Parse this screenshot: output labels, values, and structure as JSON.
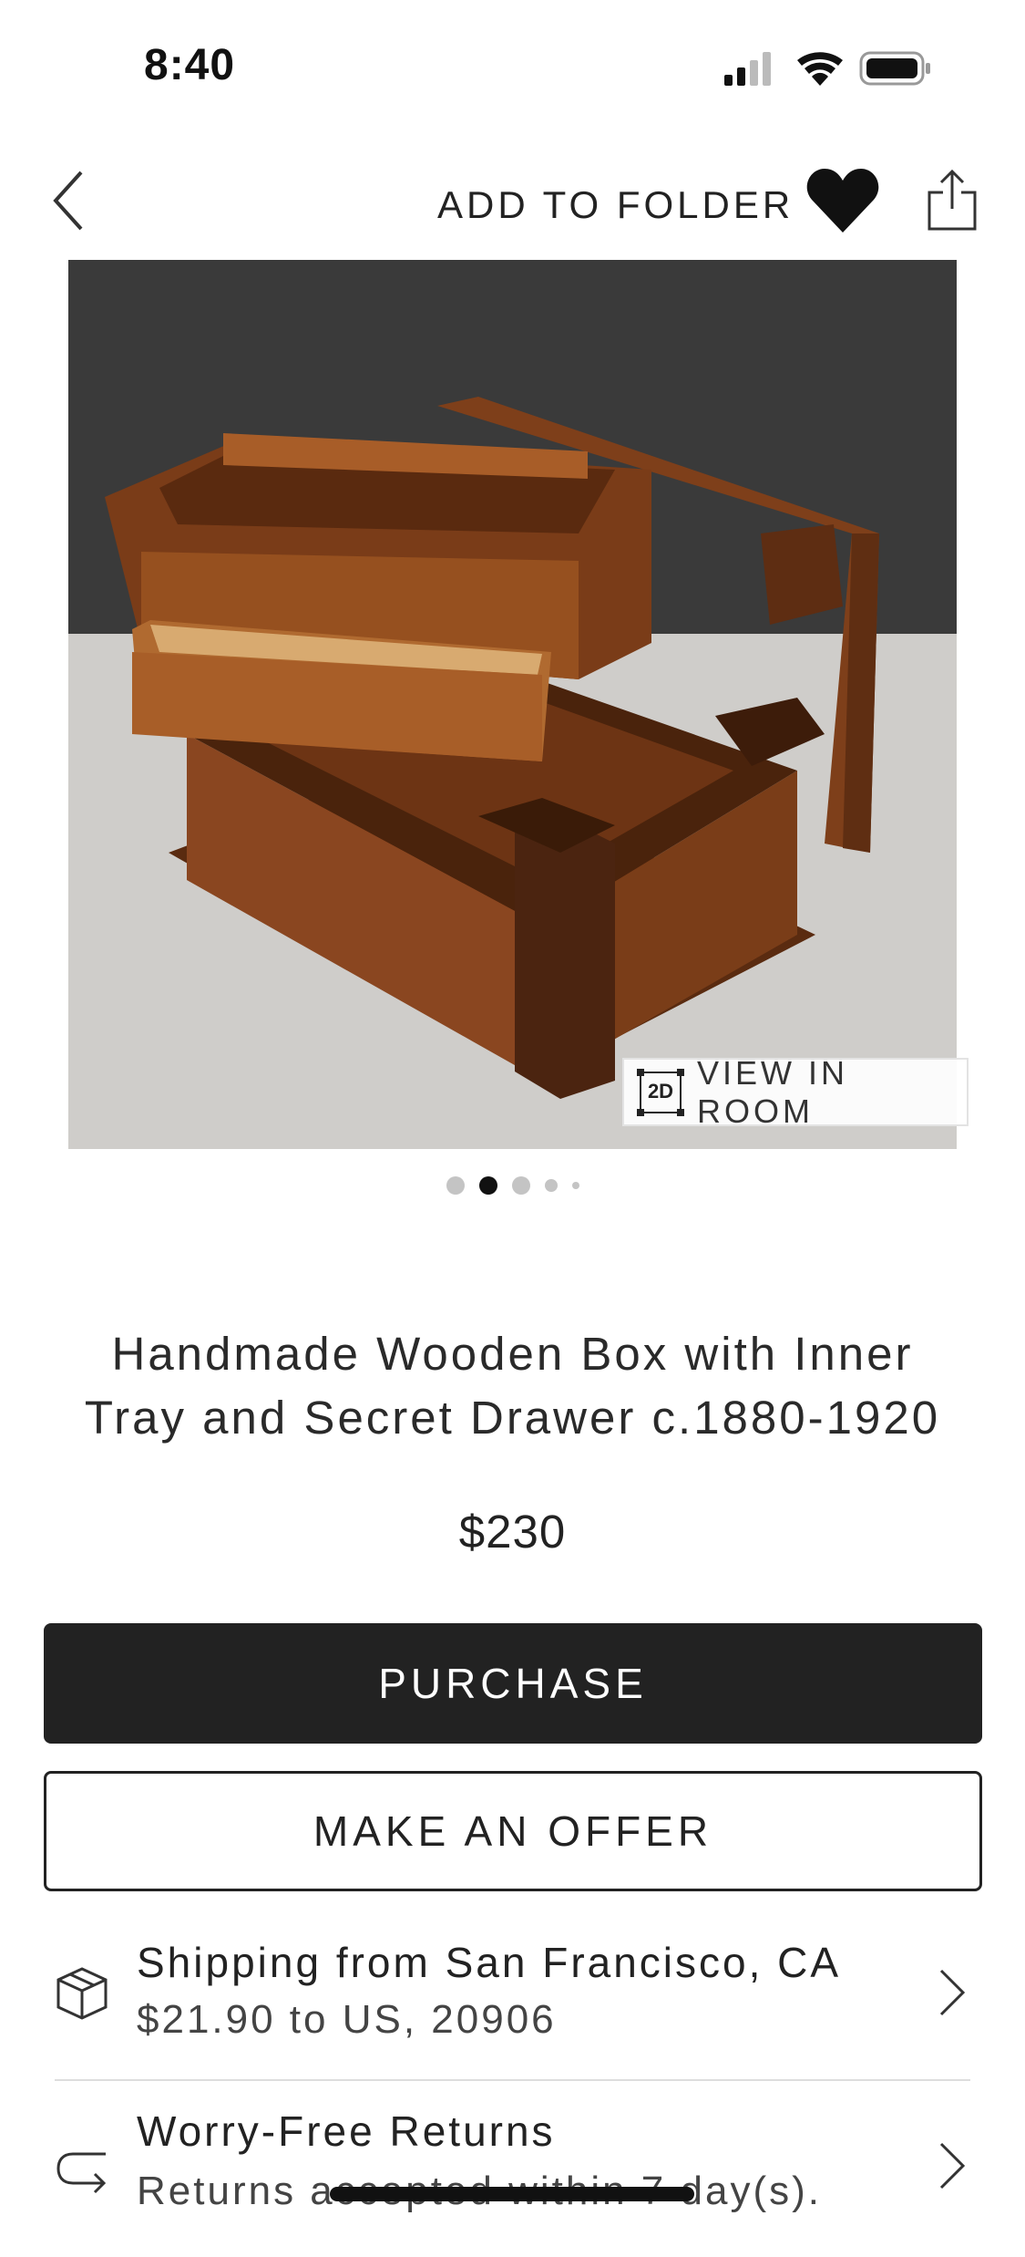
{
  "status_bar": {
    "time": "8:40"
  },
  "nav": {
    "add_to_folder": "ADD TO FOLDER",
    "back_icon": "chevron-left-icon",
    "favorite_icon": "heart-filled-icon",
    "share_icon": "share-icon"
  },
  "gallery": {
    "view_in_room_label": "VIEW IN ROOM",
    "badge_text": "2D",
    "pages": 5,
    "active_page": 2
  },
  "product": {
    "title_line1": "Handmade Wooden Box with Inner",
    "title_line2": "Tray and Secret Drawer c.1880-1920",
    "price": "$230"
  },
  "actions": {
    "purchase_label": "PURCHASE",
    "offer_label": "MAKE AN OFFER"
  },
  "shipping": {
    "title": "Shipping from San Francisco, CA",
    "detail": "$21.90 to US, 20906",
    "icon": "package-icon"
  },
  "returns": {
    "title": "Worry-Free Returns",
    "detail": "Returns accepted within 7 day(s).",
    "icon": "return-arrow-icon"
  },
  "colors": {
    "primary_button": "#222222",
    "text": "#222222",
    "wood": "#8b4a22"
  }
}
